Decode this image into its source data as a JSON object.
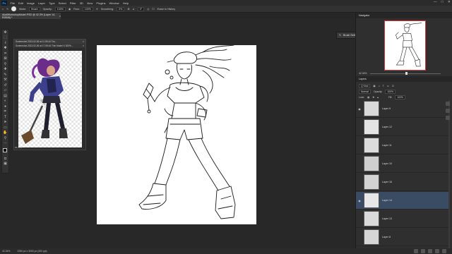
{
  "menubar": {
    "logo": "Ps",
    "items": [
      "File",
      "Edit",
      "Image",
      "Layer",
      "Type",
      "Select",
      "Filter",
      "3D",
      "View",
      "Plugins",
      "Window",
      "Help"
    ],
    "window_controls": [
      "—",
      "□",
      "✕"
    ]
  },
  "optionsbar": {
    "mode_label": "Mode:",
    "mode_value": "Brush",
    "opacity_label": "Opacity:",
    "opacity_value": "100%",
    "flow_label": "Flow:",
    "flow_value": "100%",
    "smoothing_label": "Smoothing:",
    "smoothing_value": "0%",
    "angle_value": "0°",
    "erase_history": "Erase to History"
  },
  "tab": {
    "title": "AkaliWorkshopModel.PSD @ 42.3% (Layer 14, RGB/8) *"
  },
  "reference_window": {
    "title1": "Screenshot 2023-02-06 at 11.59.44 Tra...",
    "title2": "Screenshot 2023-02-06 at 17.59.44 Thin Model X 300%...",
    "zoom": "56.38%"
  },
  "brush_popup": {
    "label": "Brush Settings"
  },
  "navigator": {
    "header": "Navigator",
    "zoom": "42.34%"
  },
  "layers": {
    "header": "Layers",
    "kind_label": "Q Kind",
    "blend_mode": "Normal",
    "opacity_label": "Opacity:",
    "opacity_value": "100%",
    "lock_label": "Lock:",
    "fill_label": "Fill:",
    "fill_value": "100%",
    "rows": [
      {
        "name": "Layer 9",
        "visible": true,
        "selected": false
      },
      {
        "name": "Layer 12",
        "visible": false,
        "selected": false
      },
      {
        "name": "Layer 11",
        "visible": false,
        "selected": false
      },
      {
        "name": "Layer 10",
        "visible": false,
        "selected": false
      },
      {
        "name": "Layer 16",
        "visible": false,
        "selected": false
      },
      {
        "name": "Layer 14",
        "visible": true,
        "selected": true
      },
      {
        "name": "Layer 13",
        "visible": false,
        "selected": false
      },
      {
        "name": "Layer 8",
        "visible": false,
        "selected": false
      }
    ]
  },
  "statusbar": {
    "zoom": "42.34%",
    "doc_size": "2250 px x 3000 px (300 ppi)"
  }
}
